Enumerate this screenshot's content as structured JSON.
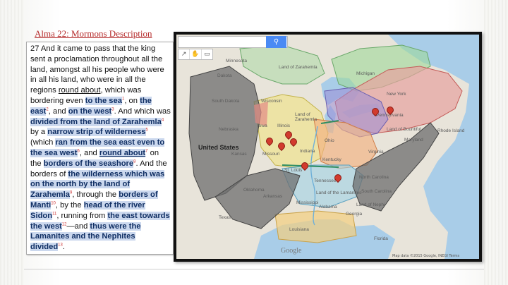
{
  "slide": {
    "title": "Alma 22: Mormons Description"
  },
  "verse": {
    "t1": "27 And it came to pass that the king sent a proclamation throughout all the land, amongst all his people who were in all his land, who were in all the regions ",
    "t2": "round about",
    "t3": ", which was bordering even ",
    "t4": "to the sea",
    "s1": "1",
    "t5": ", on ",
    "t6": "the east",
    "s2": "2",
    "t7": ", and ",
    "t8": "on the west",
    "s3": "3",
    "t9": ". And which was ",
    "t10": "divided from the land of Zarahemla",
    "s4": "4",
    "t11": " by a ",
    "t12": "narrow strip of wilderness",
    "s5": "5",
    "t13": " (which ",
    "t14": "ran from the sea east even to the sea west",
    "s6": "6",
    "t15": ", and ",
    "t16": "round about",
    "s7": "7",
    "t17": " on the ",
    "t18": "borders of the seashore",
    "s8": "8",
    "t19": ". And the borders of ",
    "t20": "the wilderness which was on the north by the land of Zarahemla",
    "s9": "9",
    "t21": ", through the ",
    "t22": "borders of Manti",
    "s10": "10",
    "t23": ", by the ",
    "t24": "head of the river Sidon",
    "s11": "11",
    "t25": ", running from ",
    "t26": "the east towards the west",
    "s12": "12",
    "t27": "—and ",
    "t28": "thus were the Lamanites and the Nephites divided",
    "s13": "13",
    "t29": "."
  },
  "map": {
    "search_icon": "search-icon",
    "search_symbol": "⚲",
    "tools": [
      "↗",
      "✋",
      "▭"
    ],
    "country_label": "United States",
    "google": "Google",
    "footer": "Map data ©2015 Google, INEGI  Terms",
    "labels": {
      "land_of_zarahemla_top": "Land of Zarahemla",
      "land_of": "Land of",
      "zarahemla": "Zarahemla",
      "lamanites": "Land of the Lamanites",
      "land_of_bountiful": "Land of Bountiful",
      "nephi": "Land of Nephi",
      "dakota": "Dakota",
      "south_dakota": "South Dakota",
      "nebraska": "Nebraska",
      "kansas": "Kansas",
      "oklahoma": "Oklahoma",
      "texas": "Texas",
      "missouri": "Missouri",
      "illinois": "Illinois",
      "indiana": "Indiana",
      "ohio": "Ohio",
      "kentucky": "Kentucky",
      "tennessee": "Tennessee",
      "georgia": "Georgia",
      "alabama": "Alabama",
      "michigan": "Michigan",
      "new_york": "New York",
      "pennsylvania": "Pennsylvania",
      "virginia": "Virginia",
      "north_carolina": "North Carolina",
      "south_carolina": "South Carolina",
      "maryland": "Maryland",
      "rhode_island": "Rhode Island",
      "st_louis": "St. Louis",
      "arkansas": "Arkansas",
      "mississippi": "Mississippi",
      "louisiana": "Louisiana",
      "florida": "Florida",
      "minnesota": "Minnesota",
      "wisconsin": "Wisconsin",
      "iowa": "Iowa"
    },
    "colors": {
      "dark_region": "#6e6e6e",
      "pink_region": "#e7a3a0",
      "yellow_region": "#efe38e",
      "orange_region": "#f3b07f",
      "blue_region": "#9fd2e6",
      "green_region": "#a9d98a",
      "purple_region": "#9b8cd6",
      "pin": "#d23b2e"
    }
  }
}
